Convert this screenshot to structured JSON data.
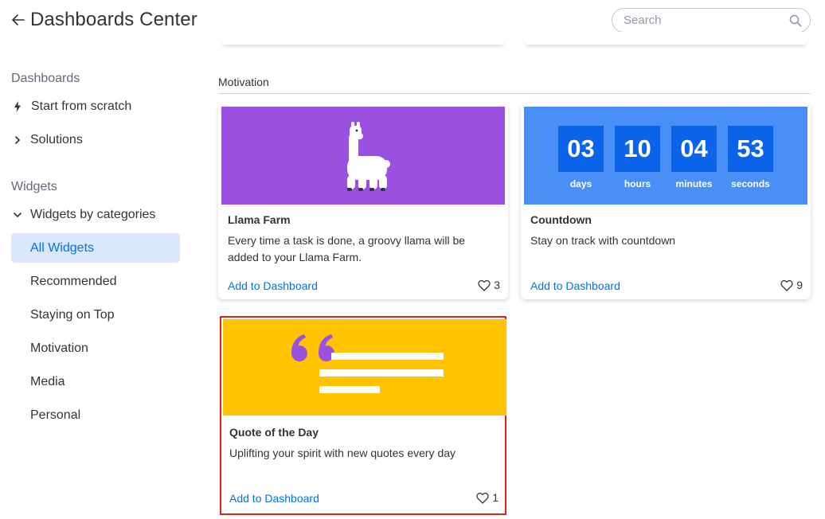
{
  "header": {
    "title": "Dashboards Center",
    "search_placeholder": "Search"
  },
  "sidebar": {
    "dashboards_title": "Dashboards",
    "dashboards_items": [
      {
        "label": "Start from scratch",
        "icon": "lightning-icon"
      },
      {
        "label": "Solutions",
        "icon": "chevron-right-icon"
      }
    ],
    "widgets_title": "Widgets",
    "widgets_group": {
      "label": "Widgets by categories",
      "icon": "chevron-down-icon"
    },
    "widgets_items": [
      {
        "label": "All Widgets",
        "active": true
      },
      {
        "label": "Recommended"
      },
      {
        "label": "Staying on Top"
      },
      {
        "label": "Motivation"
      },
      {
        "label": "Media"
      },
      {
        "label": "Personal"
      }
    ]
  },
  "main": {
    "category": "Motivation",
    "cards": [
      {
        "title": "Llama Farm",
        "description": "Every time a task is done, a groovy llama will be added to your Llama Farm.",
        "action": "Add to Dashboard",
        "likes": "3",
        "banner_color": "#9b51e0"
      },
      {
        "title": "Countdown",
        "description": "Stay on track with countdown",
        "action": "Add to Dashboard",
        "likes": "9",
        "banner_color": "#4a8ff5",
        "countdown": [
          {
            "value": "03",
            "unit": "days"
          },
          {
            "value": "10",
            "unit": "hours"
          },
          {
            "value": "04",
            "unit": "minutes"
          },
          {
            "value": "53",
            "unit": "seconds"
          }
        ]
      },
      {
        "title": "Quote of the Day",
        "description": "Uplifting your spirit with new quotes every day",
        "action": "Add to Dashboard",
        "likes": "1",
        "banner_color": "#ffc300",
        "selected": true
      }
    ]
  },
  "colors": {
    "accent": "#0073ea",
    "active_bg": "#dbe8fb",
    "selection_border": "#e2231a"
  }
}
